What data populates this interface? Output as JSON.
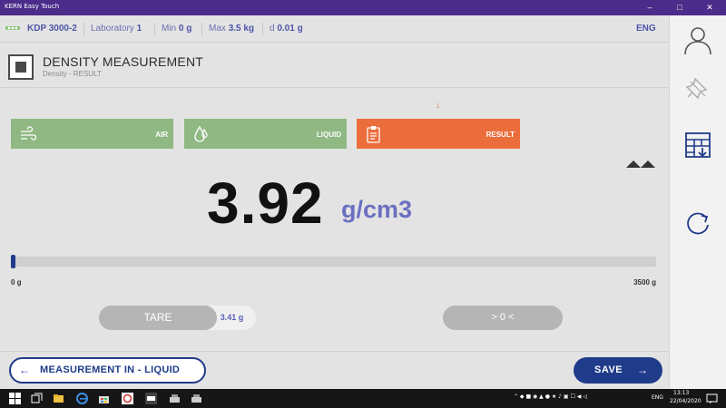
{
  "window": {
    "title": "KERN Easy Touch",
    "minimize": "–",
    "maximize": "□",
    "close": "✕"
  },
  "statusbar": {
    "model": "KDP 3000-2",
    "location_prefix": "Laboratory",
    "location_num": "1",
    "min_prefix": "Min",
    "min_value": "0 g",
    "max_prefix": "Max",
    "max_value": "3.5 kg",
    "d_prefix": "d",
    "d_value": "0.01 g",
    "language": "ENG"
  },
  "header": {
    "title": "DENSITY MEASUREMENT",
    "subtitle": "Density - RESULT"
  },
  "step_marker": "↓",
  "steps": [
    {
      "label": "AIR",
      "icon": "wind-icon",
      "state": "done",
      "color": "#8fb882"
    },
    {
      "label": "LIQUID",
      "icon": "droplet-icon",
      "state": "done",
      "color": "#8fb882"
    },
    {
      "label": "RESULT",
      "icon": "clipboard-icon",
      "state": "active",
      "color": "#eb6d3b"
    }
  ],
  "result": {
    "value": "3.92",
    "unit": "g/cm3"
  },
  "range": {
    "min_label": "0 g",
    "max_label": "3500 g",
    "fill_fraction": 0.001
  },
  "tare": {
    "label": "TARE",
    "value": "3.41 g"
  },
  "zero": {
    "label": "> 0 <"
  },
  "footer": {
    "back_arrow": "←",
    "back_label": "MEASUREMENT IN - LIQUID",
    "save_label": "SAVE",
    "save_arrow": "→"
  },
  "rightbar": {
    "icons": [
      "user-icon",
      "pin-icon",
      "export-table-icon",
      "refresh-icon"
    ]
  },
  "taskbar": {
    "time": "13:13",
    "date": "22/04/2020",
    "lang": "ENG"
  },
  "colors": {
    "accent": "#1f3b8a",
    "done": "#8fb882",
    "active": "#eb6d3b",
    "unit": "#6a70c0"
  }
}
